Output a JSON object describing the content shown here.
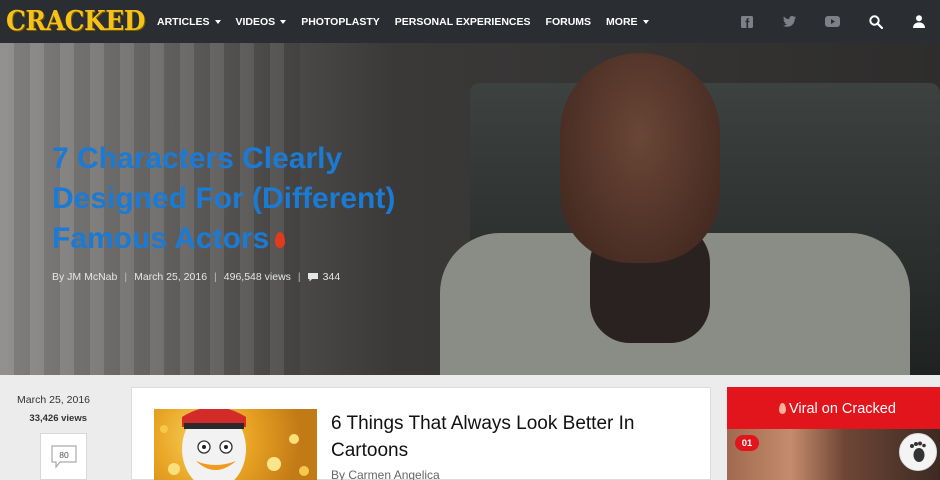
{
  "header": {
    "logo": "CRACKED",
    "nav": [
      {
        "label": "ARTICLES",
        "dropdown": true
      },
      {
        "label": "VIDEOS",
        "dropdown": true
      },
      {
        "label": "PHOTOPLASTY",
        "dropdown": false
      },
      {
        "label": "PERSONAL EXPERIENCES",
        "dropdown": false
      },
      {
        "label": "FORUMS",
        "dropdown": false
      },
      {
        "label": "MORE",
        "dropdown": true
      }
    ],
    "icons": [
      "facebook-icon",
      "twitter-icon",
      "youtube-icon",
      "search-icon",
      "user-icon"
    ]
  },
  "hero": {
    "title": "7 Characters Clearly Designed For (Different) Famous Actors",
    "author": "By JM McNab",
    "date": "March 25, 2016",
    "views": "496,548 views",
    "comments": "344"
  },
  "sidebar_left": {
    "date": "March 25, 2016",
    "views": "33,426 views",
    "comment_count": "80"
  },
  "article_card": {
    "title": "6 Things That Always Look Better In Cartoons",
    "byline": "By Carmen Angelica"
  },
  "viral": {
    "title": "Viral on Cracked",
    "badge": "01"
  },
  "colors": {
    "nav_bg": "#2a2d32",
    "logo": "#f6c21a",
    "hero_title": "#1b7ad3",
    "viral_red": "#e2141c"
  }
}
